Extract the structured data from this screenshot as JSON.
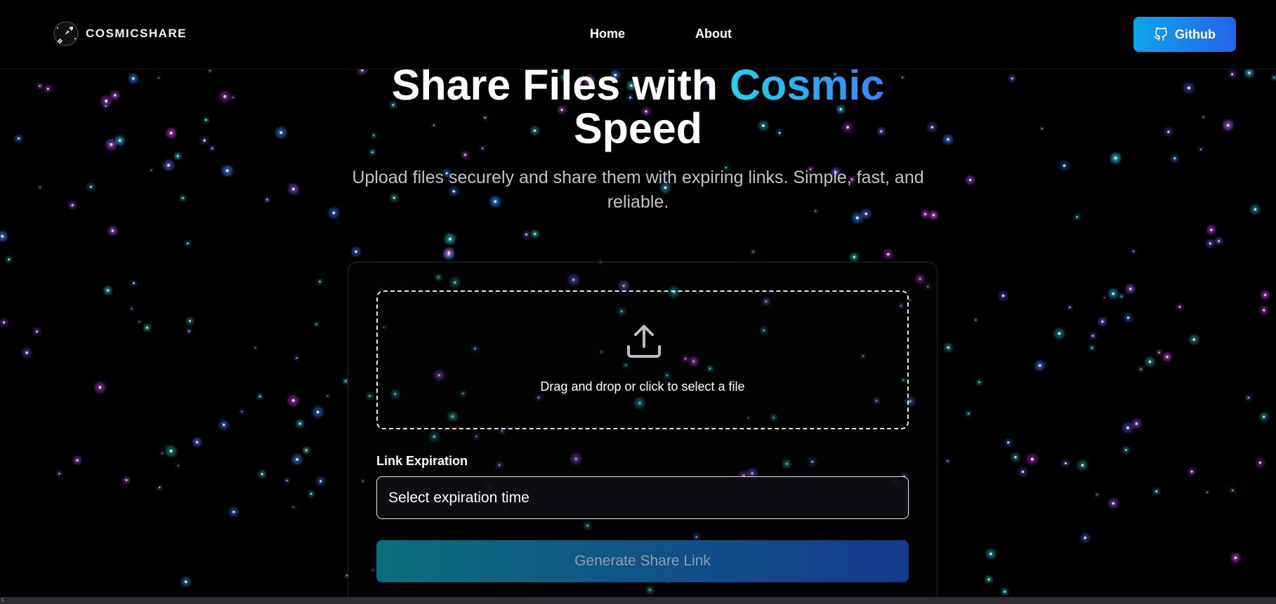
{
  "app": {
    "brand_name": "COSMICSHARE",
    "logo_icon": "rocket-icon"
  },
  "nav": {
    "items": [
      {
        "label": "Home"
      },
      {
        "label": "About"
      }
    ],
    "github_button": {
      "label": "Github",
      "icon": "github-icon"
    }
  },
  "hero": {
    "title_part1": "Share Files with ",
    "title_accent": "Cosmic",
    "title_part2": "Speed",
    "subtitle": "Upload files securely and share them with expiring links. Simple, fast, and reliable."
  },
  "upload": {
    "dropzone_icon": "upload-icon",
    "dropzone_text": "Drag and drop or click to select a file",
    "expiration_label": "Link Expiration",
    "expiration_value": "Select expiration time",
    "generate_label": "Generate Share Link"
  },
  "colors": {
    "accent_start": "#22d3ee",
    "accent_end": "#3b82f6",
    "button_start": "#0ea5e9",
    "button_end": "#2563eb",
    "background": "#000000"
  }
}
